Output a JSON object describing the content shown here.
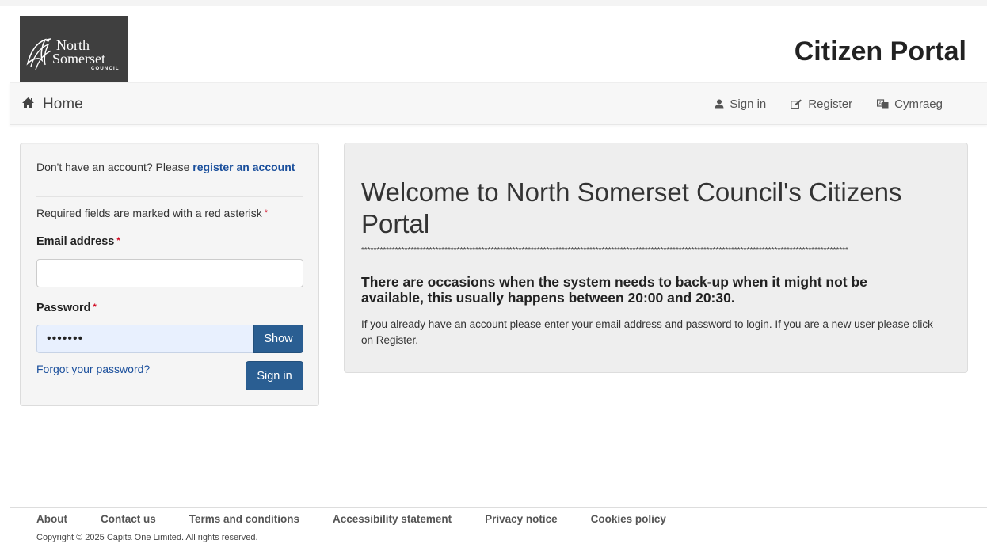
{
  "header": {
    "logo_line1": "North",
    "logo_line2": "Somerset",
    "logo_line3": "COUNCIL",
    "title": "Citizen Portal"
  },
  "nav": {
    "home_label": "Home",
    "home_icon": "home-icon",
    "links": [
      {
        "label": "Sign in",
        "icon": "user-icon"
      },
      {
        "label": "Register",
        "icon": "edit-icon"
      },
      {
        "label": "Cymraeg",
        "icon": "language-icon"
      }
    ]
  },
  "login": {
    "intro_text": "Don't have an account? Please",
    "register_link": "register an account",
    "required_note": "Required fields are marked with a red asterisk",
    "required_marker": "*",
    "email_label": "Email address",
    "email_value": "",
    "password_label": "Password",
    "password_value": "•••••••",
    "show_button": "Show",
    "forgot_link": "Forgot your password?",
    "signin_button": "Sign in"
  },
  "welcome": {
    "title": "Welcome to North Somerset Council's Citizens Portal",
    "separator": "**************************************************************************************************************************************************************",
    "notice": "There are occasions when the system needs to back-up when it might not be available, this usually happens between 20:00 and 20:30.",
    "info": "If you already have an account please enter your email address and password to login. If you are a new user please click on Register."
  },
  "footer": {
    "links": [
      "About",
      "Contact us",
      "Terms and conditions",
      "Accessibility statement",
      "Privacy notice",
      "Cookies policy"
    ],
    "copyright": "Copyright © 2025 Capita One Limited. All rights reserved."
  },
  "colors": {
    "primary_button": "#2a5e92",
    "link": "#1a4f9c",
    "required": "#d0021b",
    "logo_bg": "#3f3f3f"
  }
}
